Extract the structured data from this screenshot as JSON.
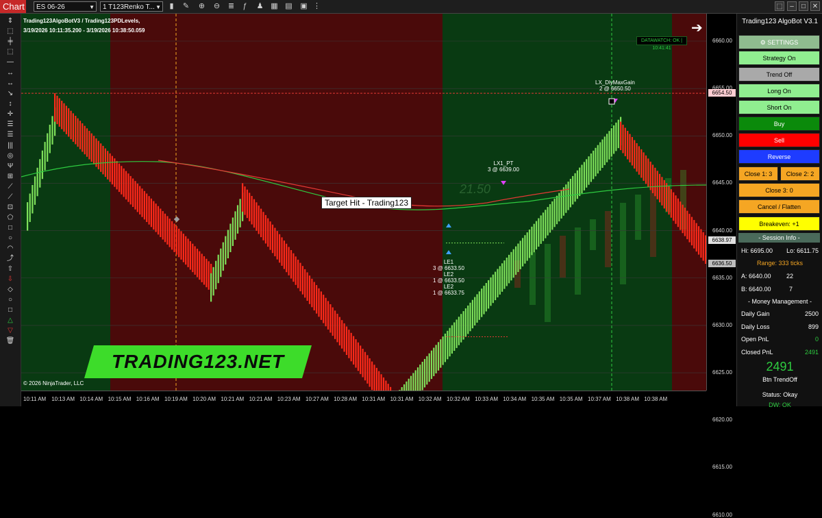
{
  "toolbar": {
    "chart_tab": "Chart",
    "instrument": "ES 06-26",
    "bar_type": "1 T123Renko T...",
    "icons": [
      "chart-type-icon",
      "drawing-icon",
      "zoom-in-icon",
      "zoom-out-icon",
      "properties-icon",
      "indicators-icon",
      "strategies-icon",
      "data-box-icon",
      "template-icon",
      "screenshot-icon",
      "more-icon"
    ],
    "window_icons": [
      "pin-icon",
      "minimize-icon",
      "maximize-icon",
      "close-icon"
    ]
  },
  "chart": {
    "scripts_label": "Trading123AlgoBotV3 / Trading123PDLevels,",
    "range_label": "3/19/2026 10:11:35.200 - 3/19/2026 10:38:50.059",
    "copyright": "© 2026 NinjaTrader, LLC",
    "datawatch": "DATAWATCH: OK | 10:41:41",
    "target_hit": "Target Hit - Trading123",
    "logo_text": "TRADING123.NET",
    "watermark_text": "21.50",
    "annotations": {
      "lx_dly_title": "LX_DlyMaxGain",
      "lx_dly_detail": "2 @ 6650.50",
      "lx1_title": "LX1_PT",
      "lx1_detail": "3 @ 6639.00",
      "le1_title": "LE1",
      "le1_detail": "3 @ 6633.50",
      "le2a_title": "LE2",
      "le2a_detail": "1 @ 6633.50",
      "le2b_title": "LE2",
      "le2b_detail": "1 @ 6633.75"
    },
    "price_levels": [
      "6660.00",
      "6655.00",
      "6650.00",
      "6645.00",
      "6640.00",
      "6635.00",
      "6630.00",
      "6625.00",
      "6620.00",
      "6615.00",
      "6610.00"
    ],
    "price_tags": {
      "red": "6654.50",
      "white": "6638.97",
      "gray": "6636.50"
    },
    "time_labels": [
      "10:11 AM",
      "10:13 AM",
      "10:14 AM",
      "10:15 AM",
      "10:16 AM",
      "10:19 AM",
      "10:20 AM",
      "10:21 AM",
      "10:21 AM",
      "10:23 AM",
      "10:27 AM",
      "10:28 AM",
      "10:31 AM",
      "10:31 AM",
      "10:32 AM",
      "10:32 AM",
      "10:33 AM",
      "10:34 AM",
      "10:35 AM",
      "10:35 AM",
      "10:37 AM",
      "10:38 AM",
      "10:38 AM"
    ],
    "colors": {
      "green_bg": "#093a12",
      "red_bg": "#4a0a0a",
      "up_bar": "#7ee05a",
      "down_bar": "#ff2a1a",
      "accent": "#c62828"
    }
  },
  "panel": {
    "title": "Trading123 AlgoBot V3.1",
    "settings": "⚙ SETTINGS",
    "strategy_on": "Strategy On",
    "trend_off": "Trend Off",
    "long_on": "Long On",
    "short_on": "Short On",
    "buy": "Buy",
    "sell": "Sell",
    "reverse": "Reverse",
    "close1": "Close 1:  3",
    "close2": "Close 2:  2",
    "close3": "Close 3:  0",
    "cancel_flatten": "Cancel / Flatten",
    "breakeven": "Breakeven:  +1",
    "session_info": "-  Session Info  -",
    "hi": "Hi: 6695.00",
    "lo": "Lo: 6611.75",
    "range": "Range: 333 ticks",
    "a_label": "A: 6640.00",
    "a_value": "22",
    "b_label": "B: 6640.00",
    "b_value": "7",
    "money_mgmt": "-  Money Management  -",
    "daily_gain_label": "Daily Gain",
    "daily_gain": "2500",
    "daily_loss_label": "Daily Loss",
    "daily_loss": "899",
    "open_pnl_label": "Open PnL",
    "open_pnl": "0",
    "closed_pnl_label": "Closed PnL",
    "closed_pnl": "2491",
    "closed_big": "2491",
    "btn_trend": "Btn TrendOff",
    "status": "Status: Okay",
    "dw": "DW: OK"
  }
}
